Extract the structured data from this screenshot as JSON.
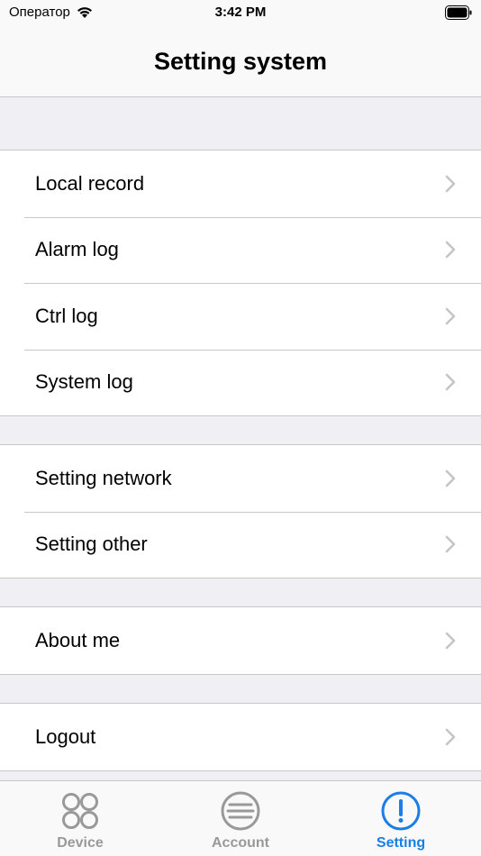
{
  "status_bar": {
    "carrier": "Оператор",
    "time": "3:42 PM"
  },
  "nav": {
    "title": "Setting system"
  },
  "groups": [
    {
      "items": [
        {
          "label": "Local record"
        },
        {
          "label": "Alarm log"
        },
        {
          "label": "Ctrl log"
        },
        {
          "label": "System log"
        }
      ]
    },
    {
      "items": [
        {
          "label": "Setting network"
        },
        {
          "label": "Setting other"
        }
      ]
    },
    {
      "items": [
        {
          "label": "About me"
        }
      ]
    },
    {
      "items": [
        {
          "label": "Logout"
        }
      ]
    }
  ],
  "tabs": [
    {
      "label": "Device",
      "icon": "four-circles-icon",
      "active": false
    },
    {
      "label": "Account",
      "icon": "list-circle-icon",
      "active": false
    },
    {
      "label": "Setting",
      "icon": "exclamation-circle-icon",
      "active": true
    }
  ],
  "colors": {
    "accent": "#1a7ee6",
    "inactive": "#999999",
    "background": "#efeff4",
    "separator": "#c8c7cc"
  }
}
